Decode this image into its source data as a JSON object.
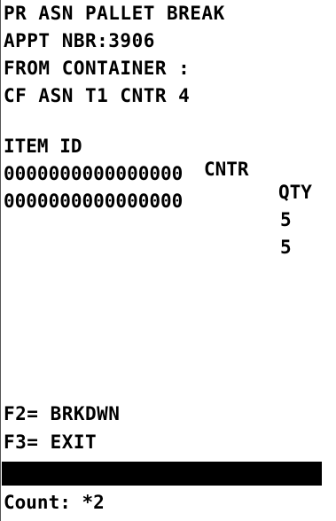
{
  "header": {
    "title": "PR ASN PALLET BREAK",
    "appt": "APPT NBR:3906",
    "from_container_label": "FROM CONTAINER :",
    "container_value": "CF ASN T1 CNTR 4"
  },
  "table": {
    "columns": {
      "item_id": "ITEM ID",
      "cntr": "CNTR",
      "qty": "QTY"
    },
    "rows": [
      {
        "item_id": "0000000000000000",
        "cntr": "",
        "qty": "5"
      },
      {
        "item_id": "0000000000000000",
        "cntr": "",
        "qty": "5"
      }
    ]
  },
  "function_keys": {
    "f2": "F2= BRKDWN",
    "f3": "F3= EXIT"
  },
  "input": {
    "value": ""
  },
  "status": {
    "count": "Count: *2"
  }
}
